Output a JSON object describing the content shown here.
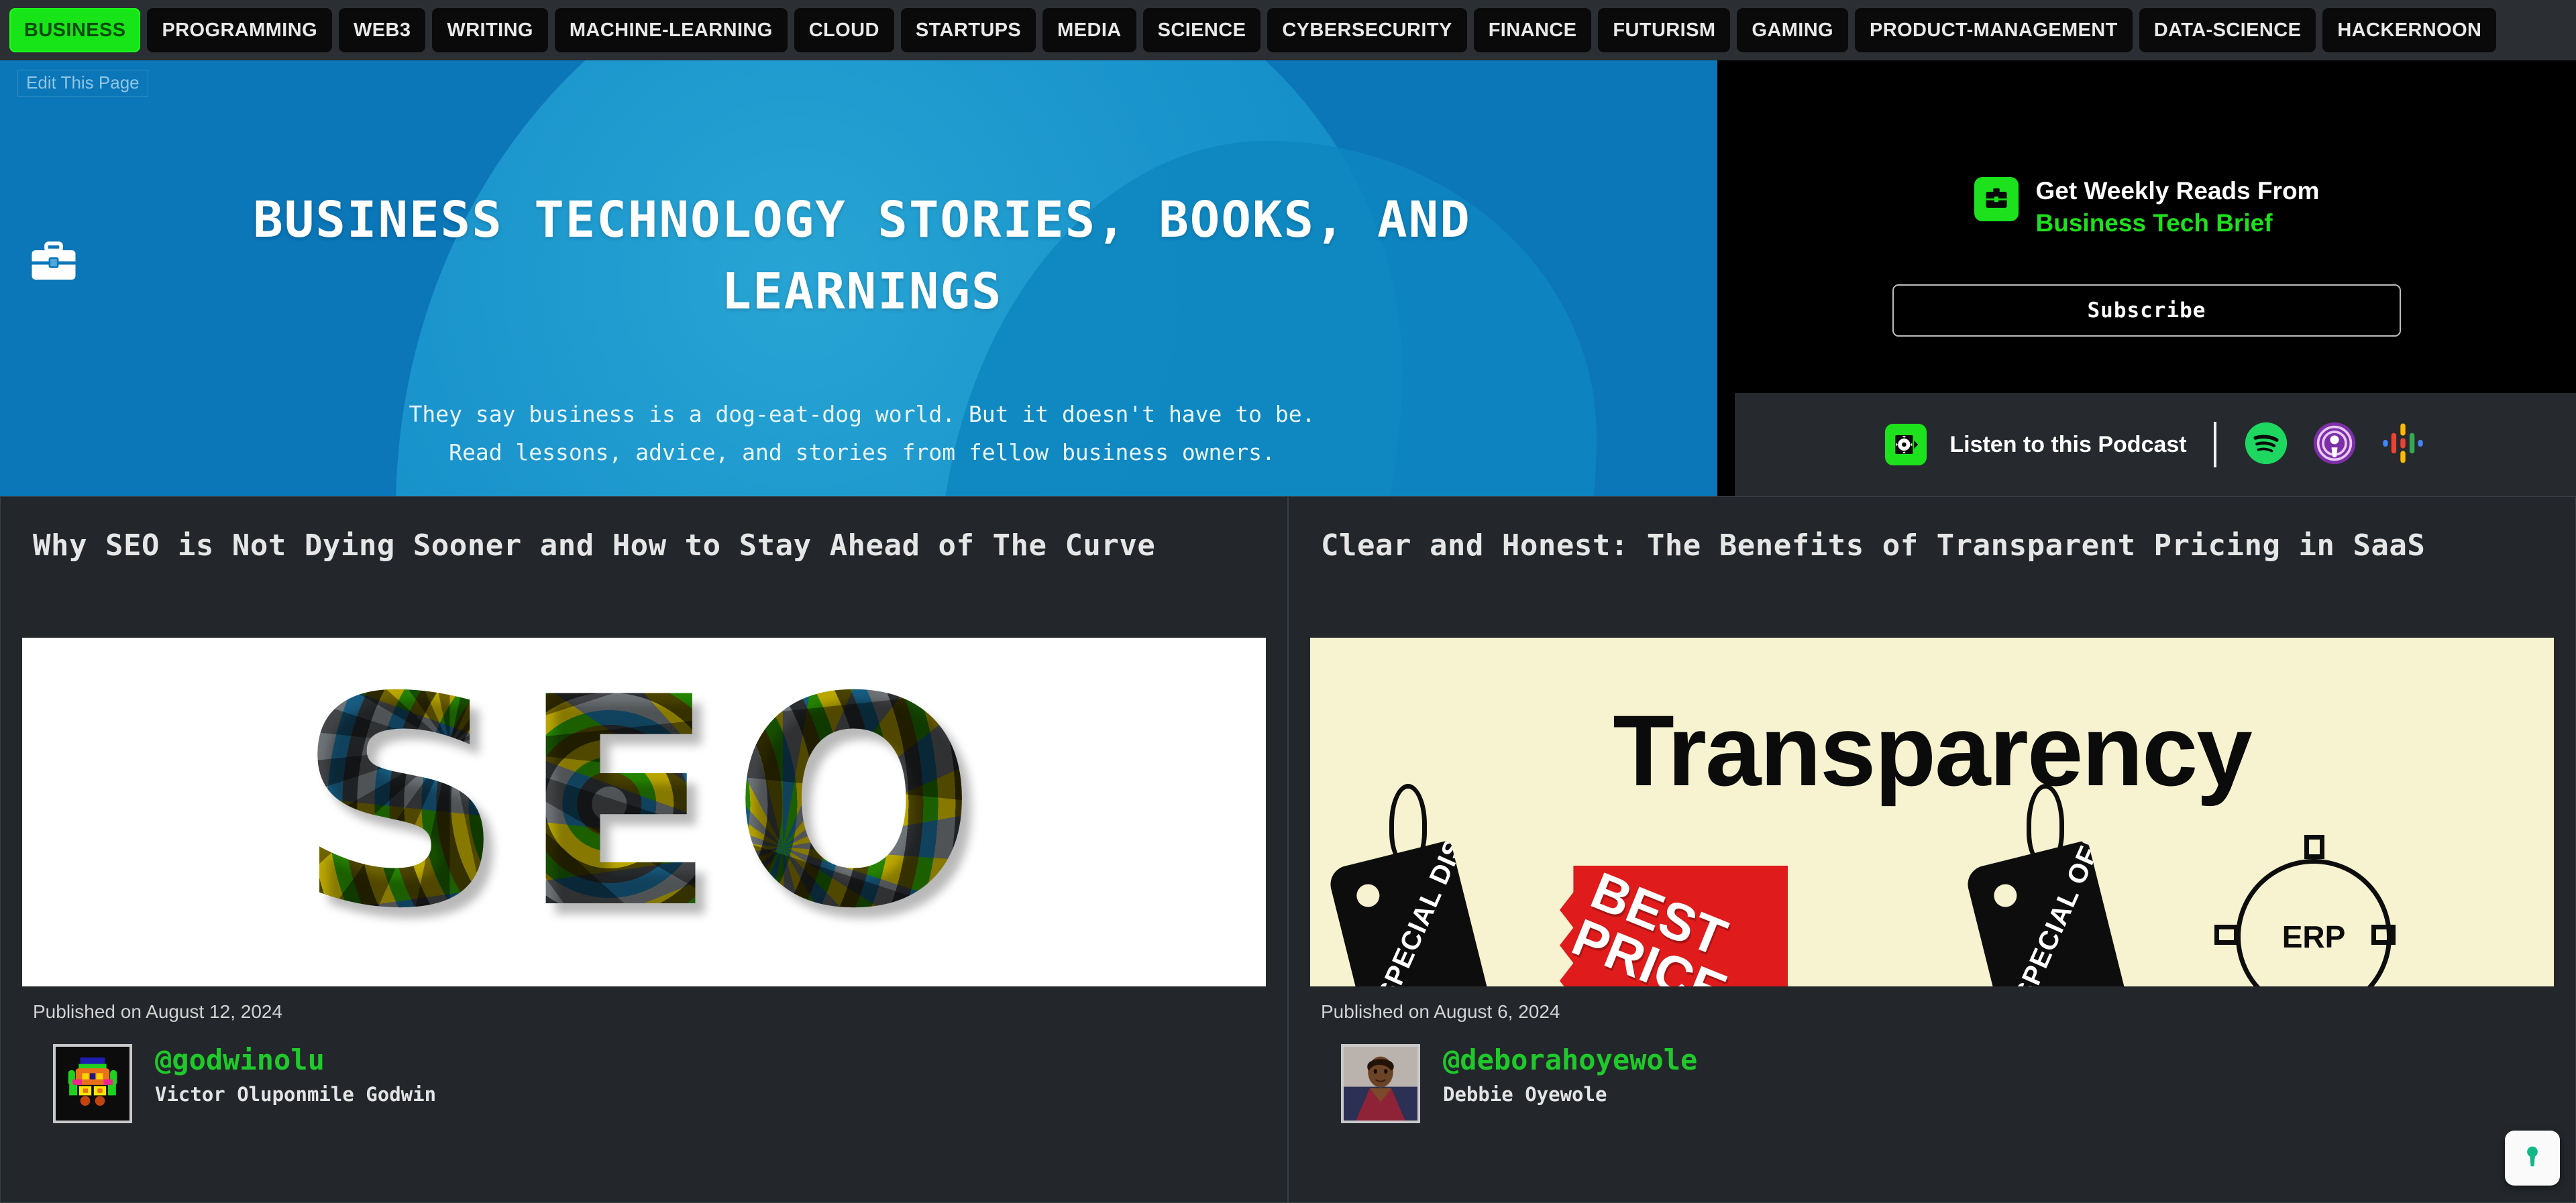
{
  "nav": {
    "tabs": [
      {
        "label": "BUSINESS",
        "active": true
      },
      {
        "label": "PROGRAMMING",
        "active": false
      },
      {
        "label": "WEB3",
        "active": false
      },
      {
        "label": "WRITING",
        "active": false
      },
      {
        "label": "MACHINE-LEARNING",
        "active": false
      },
      {
        "label": "CLOUD",
        "active": false
      },
      {
        "label": "STARTUPS",
        "active": false
      },
      {
        "label": "MEDIA",
        "active": false
      },
      {
        "label": "SCIENCE",
        "active": false
      },
      {
        "label": "CYBERSECURITY",
        "active": false
      },
      {
        "label": "FINANCE",
        "active": false
      },
      {
        "label": "FUTURISM",
        "active": false
      },
      {
        "label": "GAMING",
        "active": false
      },
      {
        "label": "PRODUCT-MANAGEMENT",
        "active": false
      },
      {
        "label": "DATA-SCIENCE",
        "active": false
      },
      {
        "label": "HACKERNOON",
        "active": false
      }
    ],
    "active_color": "#18e518",
    "tab_bg": "#0a0a0a"
  },
  "hero": {
    "edit_button_label": "Edit This Page",
    "icon_name": "briefcase-icon",
    "title": "BUSINESS TECHNOLOGY STORIES, BOOKS, AND LEARNINGS",
    "subtitle_line1": "They say business is a dog-eat-dog world. But it doesn't have to be.",
    "subtitle_line2": "Read lessons, advice, and stories from fellow business owners.",
    "background_color": "#0b76b8",
    "blob_color": "#2aa8d6"
  },
  "newsletter": {
    "icon_name": "briefcase-badge-icon",
    "heading": "Get Weekly Reads From",
    "brand": "Business Tech Brief",
    "brand_color": "#1ce11c",
    "subscribe_label": "Subscribe"
  },
  "podcast": {
    "icon_name": "podcast-gear-icon",
    "label": "Listen to this Podcast",
    "platforms": [
      {
        "name": "spotify-icon",
        "color": "#1ed760"
      },
      {
        "name": "apple-podcasts-icon",
        "color": "#a855d6"
      },
      {
        "name": "google-podcasts-icon",
        "color": "#4285f4"
      }
    ]
  },
  "cards": [
    {
      "title": "Why SEO is Not Dying Sooner and How to Stay Ahead of The Curve",
      "image_name": "seo-gears-artwork",
      "image_text": "SEO",
      "date": "Published on August 12, 2024",
      "handle": "@godwinolu",
      "author": "Victor Oluponmile Godwin",
      "avatar_name": "robot-avatar"
    },
    {
      "title": "Clear and Honest: The Benefits of Transparent Pricing in SaaS",
      "image_name": "transparency-pricing-artwork",
      "image_text": "Transparency",
      "image_tag_left": "SPECIAL DISCOUNT",
      "image_tag_right": "SPECIAL OFFER",
      "image_badge": "BEST PRICE",
      "image_erp": "ERP",
      "date": "Published on August 6, 2024",
      "handle": "@deborahoyewole",
      "author": "Debbie Oyewole",
      "avatar_name": "photo-avatar"
    }
  ],
  "float_widget": {
    "icon_name": "privacy-keyhole-icon",
    "color": "#12b886"
  }
}
